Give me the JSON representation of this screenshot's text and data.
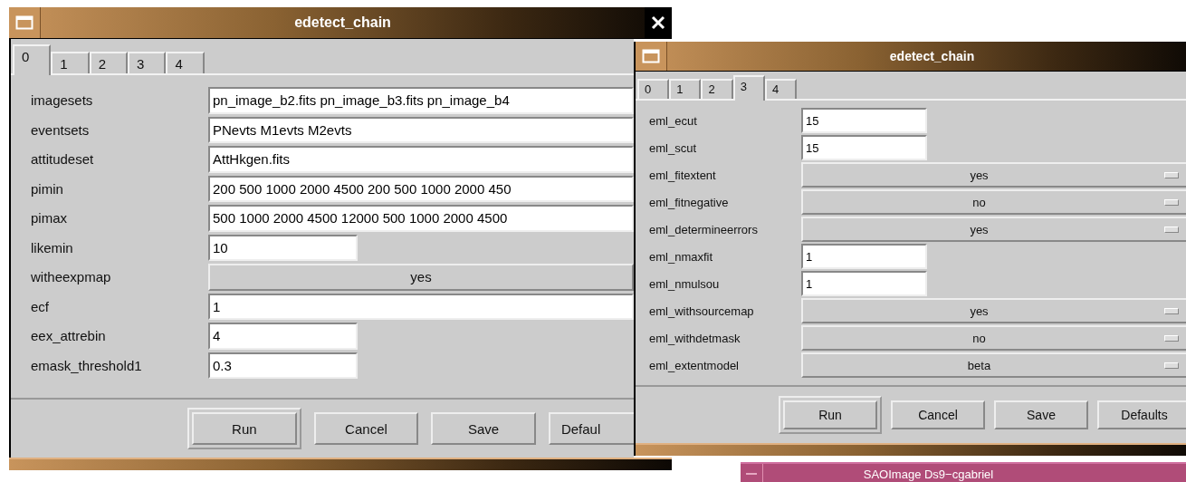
{
  "windows": [
    {
      "kind": "dialog",
      "title": "edetect_chain",
      "closable": true,
      "tabs": [
        {
          "label": "0",
          "selected": true
        },
        {
          "label": "1",
          "selected": false
        },
        {
          "label": "2",
          "selected": false
        },
        {
          "label": "3",
          "selected": false
        },
        {
          "label": "4",
          "selected": false
        }
      ],
      "params": [
        {
          "label": "imagesets",
          "kind": "wide",
          "value": "pn_image_b2.fits pn_image_b3.fits pn_image_b4"
        },
        {
          "label": "eventsets",
          "kind": "wide",
          "value": "PNevts M1evts M2evts"
        },
        {
          "label": "attitudeset",
          "kind": "wide",
          "value": "AttHkgen.fits"
        },
        {
          "label": "pimin",
          "kind": "wide",
          "value": "200 500 1000 2000 4500 200 500 1000 2000 450"
        },
        {
          "label": "pimax",
          "kind": "wide",
          "value": "500 1000 2000 4500 12000 500 1000 2000 4500"
        },
        {
          "label": "likemin",
          "kind": "entry",
          "value": "10"
        },
        {
          "label": "witheexpmap",
          "kind": "menu",
          "value": "yes"
        },
        {
          "label": "ecf",
          "kind": "wide",
          "value": "1"
        },
        {
          "label": "eex_attrebin",
          "kind": "entry",
          "value": "4"
        },
        {
          "label": "emask_threshold1",
          "kind": "entry",
          "value": "0.3"
        }
      ],
      "buttons": [
        {
          "label": "Run",
          "default": true
        },
        {
          "label": "Cancel",
          "default": false
        },
        {
          "label": "Save",
          "default": false
        },
        {
          "label": "Defaul",
          "default": false
        }
      ]
    },
    {
      "kind": "dialog",
      "title": "edetect_chain",
      "closable": false,
      "tabs": [
        {
          "label": "0",
          "selected": false
        },
        {
          "label": "1",
          "selected": false
        },
        {
          "label": "2",
          "selected": false
        },
        {
          "label": "3",
          "selected": true
        },
        {
          "label": "4",
          "selected": false
        }
      ],
      "params": [
        {
          "label": "eml_ecut",
          "kind": "entry",
          "value": "15"
        },
        {
          "label": "eml_scut",
          "kind": "entry",
          "value": "15"
        },
        {
          "label": "eml_fitextent",
          "kind": "menu",
          "value": "yes"
        },
        {
          "label": "eml_fitnegative",
          "kind": "menu",
          "value": "no"
        },
        {
          "label": "eml_determineerrors",
          "kind": "menu",
          "value": "yes"
        },
        {
          "label": "eml_nmaxfit",
          "kind": "entry",
          "value": "1"
        },
        {
          "label": "eml_nmulsou",
          "kind": "entry",
          "value": "1"
        },
        {
          "label": "eml_withsourcemap",
          "kind": "menu",
          "value": "yes"
        },
        {
          "label": "eml_withdetmask",
          "kind": "menu",
          "value": "no"
        },
        {
          "label": "eml_extentmodel",
          "kind": "menu",
          "value": "beta"
        }
      ],
      "buttons": [
        {
          "label": "Run",
          "default": true
        },
        {
          "label": "Cancel",
          "default": false
        },
        {
          "label": "Save",
          "default": false
        },
        {
          "label": "Defaults",
          "default": false
        }
      ]
    },
    {
      "kind": "viewer",
      "title": "SAOImage Ds9−cgabriel"
    }
  ]
}
